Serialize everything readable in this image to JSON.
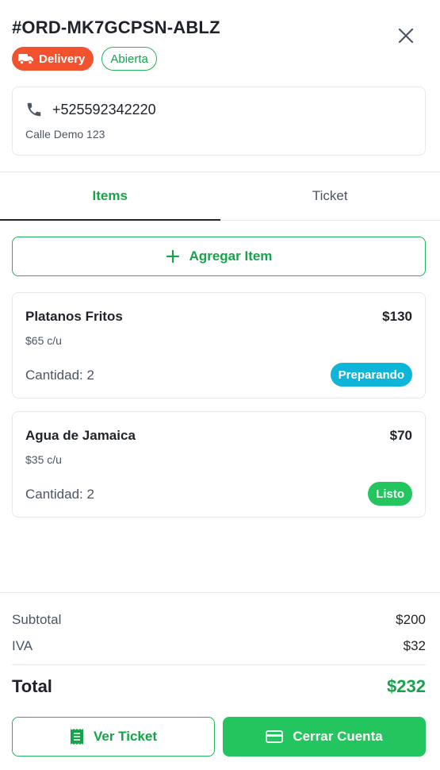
{
  "order": {
    "id": "#ORD-MK7GCPSN-ABLZ",
    "type_badge": "Delivery",
    "status_badge": "Abierta"
  },
  "contact": {
    "phone": "+525592342220",
    "address": "Calle Demo 123"
  },
  "tabs": [
    {
      "label": "Items",
      "active": true
    },
    {
      "label": "Ticket",
      "active": false
    }
  ],
  "actions": {
    "add_item": "Agregar Item",
    "view_ticket": "Ver Ticket",
    "close_account": "Cerrar Cuenta"
  },
  "items": [
    {
      "name": "Platanos Fritos",
      "total": "$130",
      "unit_price": "$65 c/u",
      "quantity": "Cantidad: 2",
      "status": "Preparando",
      "status_color": "#0fb5d8"
    },
    {
      "name": "Agua de Jamaica",
      "total": "$70",
      "unit_price": "$35 c/u",
      "quantity": "Cantidad: 2",
      "status": "Listo",
      "status_color": "#22c55e"
    }
  ],
  "summary": {
    "subtotal_label": "Subtotal",
    "subtotal": "$200",
    "tax_label": "IVA",
    "tax": "$32",
    "total_label": "Total",
    "total": "$232"
  },
  "colors": {
    "accent": "#16a34a",
    "delivery": "#f2522e",
    "primary_button": "#22c55e"
  },
  "icons": {
    "close": "close-icon",
    "truck": "truck-icon",
    "phone": "phone-icon",
    "plus": "plus-icon",
    "receipt": "receipt-icon",
    "card": "credit-card-icon"
  }
}
